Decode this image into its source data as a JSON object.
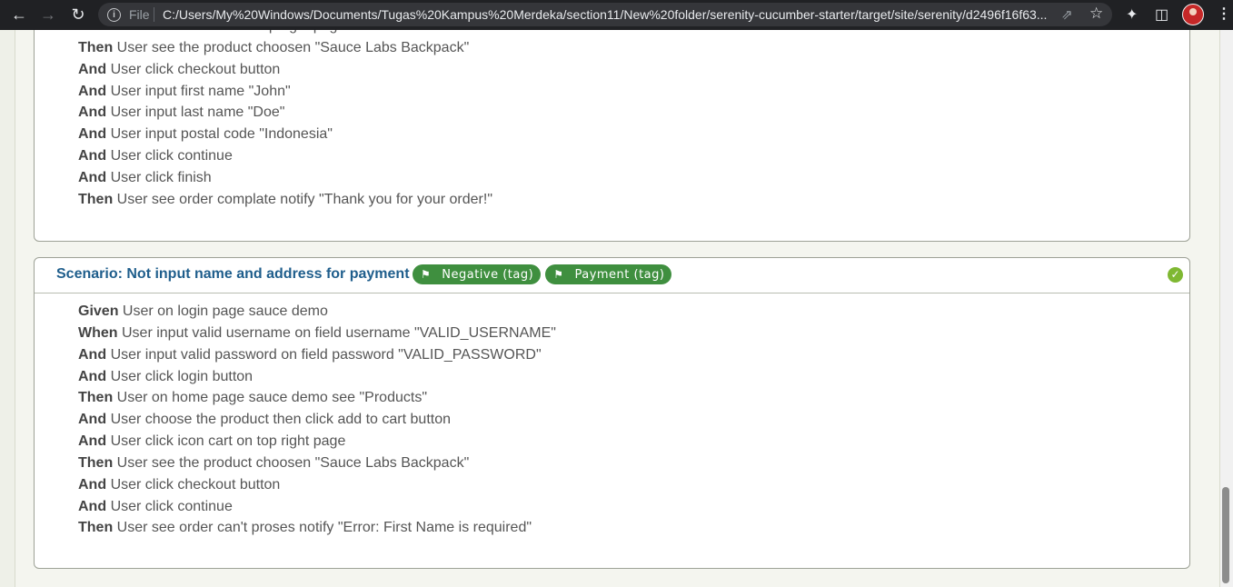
{
  "browser": {
    "file_label": "File",
    "url": "C:/Users/My%20Windows/Documents/Tugas%20Kampus%20Merdeka/section11/New%20folder/serenity-cucumber-starter/target/site/serenity/d2496f16f63..."
  },
  "previous_scenario": {
    "steps": [
      {
        "keyword": "And",
        "text": "User click icon cart on top right page"
      },
      {
        "keyword": "Then",
        "text": "User see the product choosen \"Sauce Labs Backpack\""
      },
      {
        "keyword": "And",
        "text": "User click checkout button"
      },
      {
        "keyword": "And",
        "text": "User input first name \"John\""
      },
      {
        "keyword": "And",
        "text": "User input last name \"Doe\""
      },
      {
        "keyword": "And",
        "text": "User input postal code \"Indonesia\""
      },
      {
        "keyword": "And",
        "text": "User click continue"
      },
      {
        "keyword": "And",
        "text": "User click finish"
      },
      {
        "keyword": "Then",
        "text": "User see order complate notify \"Thank you for your order!\""
      }
    ]
  },
  "scenario": {
    "title": "Scenario: Not input name and address for payment",
    "tags": [
      "Negative (tag)",
      "Payment (tag)"
    ],
    "status": "passed",
    "steps": [
      {
        "keyword": "Given",
        "text": "User on login page sauce demo"
      },
      {
        "keyword": "When",
        "text": "User input valid username on field username \"VALID_USERNAME\""
      },
      {
        "keyword": "And",
        "text": "User input valid password on field password \"VALID_PASSWORD\""
      },
      {
        "keyword": "And",
        "text": "User click login button"
      },
      {
        "keyword": "Then",
        "text": "User on home page sauce demo see \"Products\""
      },
      {
        "keyword": "And",
        "text": "User choose the product then click add to cart button"
      },
      {
        "keyword": "And",
        "text": "User click icon cart on top right page"
      },
      {
        "keyword": "Then",
        "text": "User see the product choosen \"Sauce Labs Backpack\""
      },
      {
        "keyword": "And",
        "text": "User click checkout button"
      },
      {
        "keyword": "And",
        "text": "User click continue"
      },
      {
        "keyword": "Then",
        "text": "User see order can't proses notify \"Error: First Name is required\""
      }
    ]
  },
  "colors": {
    "tag_bg": "#3f8f3f",
    "title": "#1f5e8c",
    "pass": "#7fb832"
  }
}
